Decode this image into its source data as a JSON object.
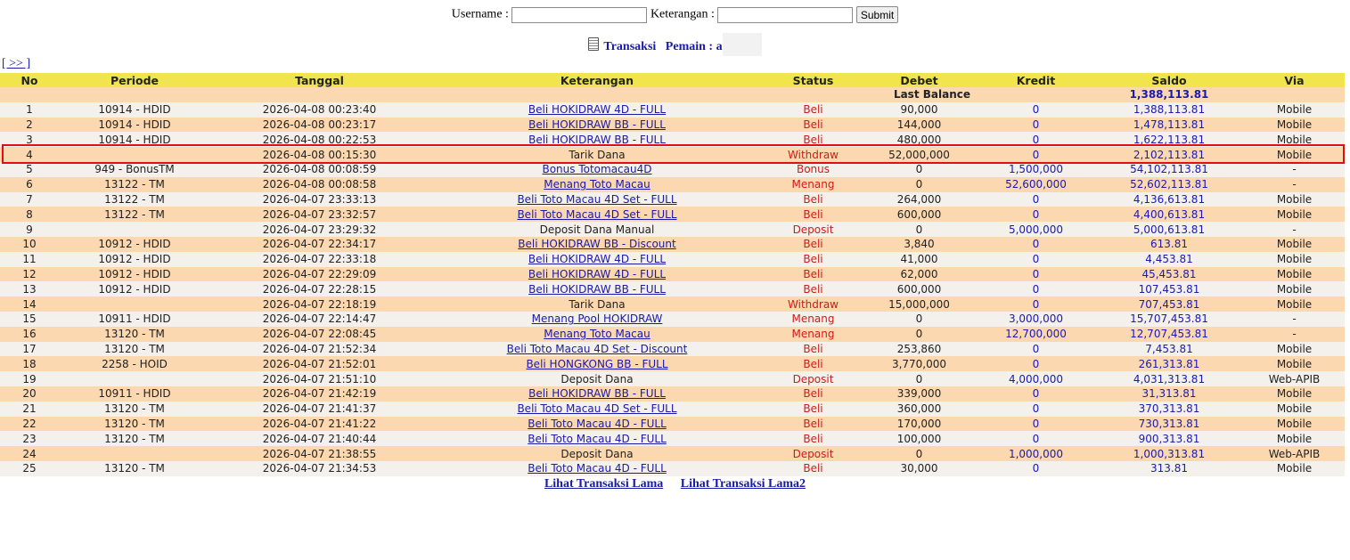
{
  "search": {
    "username_label": "Username :",
    "keterangan_label": "Keterangan :",
    "submit_label": "Submit"
  },
  "caption": {
    "title": "Transaksi",
    "player_label": "Pemain : a",
    "icon": "document-icon"
  },
  "nav": {
    "next_label": "[ >> ]"
  },
  "table": {
    "headers": [
      "No",
      "Periode",
      "Tanggal",
      "Keterangan",
      "Status",
      "Debet",
      "Kredit",
      "Saldo",
      "Via"
    ],
    "last_balance_label": "Last Balance",
    "last_balance_value": "1,388,113.81",
    "rows": [
      {
        "no": "1",
        "periode": "10914 - HDID",
        "tanggal": "2026-04-08 00:23:40",
        "ket": "Beli HOKIDRAW 4D - FULL",
        "link": true,
        "status": "Beli",
        "debet": "90,000",
        "kredit": "0",
        "saldo": "1,388,113.81",
        "via": "Mobile"
      },
      {
        "no": "2",
        "periode": "10914 - HDID",
        "tanggal": "2026-04-08 00:23:17",
        "ket": "Beli HOKIDRAW BB - FULL",
        "link": true,
        "status": "Beli",
        "debet": "144,000",
        "kredit": "0",
        "saldo": "1,478,113.81",
        "via": "Mobile"
      },
      {
        "no": "3",
        "periode": "10914 - HDID",
        "tanggal": "2026-04-08 00:22:53",
        "ket": "Beli HOKIDRAW BB - FULL",
        "link": true,
        "status": "Beli",
        "debet": "480,000",
        "kredit": "0",
        "saldo": "1,622,113.81",
        "via": "Mobile"
      },
      {
        "no": "4",
        "periode": "",
        "tanggal": "2026-04-08 00:15:30",
        "ket": "Tarik Dana",
        "link": false,
        "status": "Withdraw",
        "debet": "52,000,000",
        "kredit": "0",
        "saldo": "2,102,113.81",
        "via": "Mobile"
      },
      {
        "no": "5",
        "periode": "949 - BonusTM",
        "tanggal": "2026-04-08 00:08:59",
        "ket": "Bonus Totomacau4D",
        "link": true,
        "status": "Bonus",
        "debet": "0",
        "kredit": "1,500,000",
        "saldo": "54,102,113.81",
        "via": "-"
      },
      {
        "no": "6",
        "periode": "13122 - TM",
        "tanggal": "2026-04-08 00:08:58",
        "ket": "Menang Toto Macau",
        "link": true,
        "status": "Menang",
        "debet": "0",
        "kredit": "52,600,000",
        "saldo": "52,602,113.81",
        "via": "-"
      },
      {
        "no": "7",
        "periode": "13122 - TM",
        "tanggal": "2026-04-07 23:33:13",
        "ket": "Beli Toto Macau 4D Set - FULL",
        "link": true,
        "status": "Beli",
        "debet": "264,000",
        "kredit": "0",
        "saldo": "4,136,613.81",
        "via": "Mobile"
      },
      {
        "no": "8",
        "periode": "13122 - TM",
        "tanggal": "2026-04-07 23:32:57",
        "ket": "Beli Toto Macau 4D Set - FULL",
        "link": true,
        "status": "Beli",
        "debet": "600,000",
        "kredit": "0",
        "saldo": "4,400,613.81",
        "via": "Mobile"
      },
      {
        "no": "9",
        "periode": "",
        "tanggal": "2026-04-07 23:29:32",
        "ket": "Deposit Dana Manual",
        "link": false,
        "status": "Deposit",
        "debet": "0",
        "kredit": "5,000,000",
        "saldo": "5,000,613.81",
        "via": "-"
      },
      {
        "no": "10",
        "periode": "10912 - HDID",
        "tanggal": "2026-04-07 22:34:17",
        "ket": "Beli HOKIDRAW BB - Discount",
        "link": true,
        "status": "Beli",
        "debet": "3,840",
        "kredit": "0",
        "saldo": "613.81",
        "via": "Mobile"
      },
      {
        "no": "11",
        "periode": "10912 - HDID",
        "tanggal": "2026-04-07 22:33:18",
        "ket": "Beli HOKIDRAW 4D - FULL",
        "link": true,
        "status": "Beli",
        "debet": "41,000",
        "kredit": "0",
        "saldo": "4,453.81",
        "via": "Mobile"
      },
      {
        "no": "12",
        "periode": "10912 - HDID",
        "tanggal": "2026-04-07 22:29:09",
        "ket": "Beli HOKIDRAW 4D - FULL",
        "link": true,
        "status": "Beli",
        "debet": "62,000",
        "kredit": "0",
        "saldo": "45,453.81",
        "via": "Mobile"
      },
      {
        "no": "13",
        "periode": "10912 - HDID",
        "tanggal": "2026-04-07 22:28:15",
        "ket": "Beli HOKIDRAW BB - FULL",
        "link": true,
        "status": "Beli",
        "debet": "600,000",
        "kredit": "0",
        "saldo": "107,453.81",
        "via": "Mobile"
      },
      {
        "no": "14",
        "periode": "",
        "tanggal": "2026-04-07 22:18:19",
        "ket": "Tarik Dana",
        "link": false,
        "status": "Withdraw",
        "debet": "15,000,000",
        "kredit": "0",
        "saldo": "707,453.81",
        "via": "Mobile"
      },
      {
        "no": "15",
        "periode": "10911 - HDID",
        "tanggal": "2026-04-07 22:14:47",
        "ket": "Menang Pool HOKIDRAW",
        "link": true,
        "status": "Menang",
        "debet": "0",
        "kredit": "3,000,000",
        "saldo": "15,707,453.81",
        "via": "-"
      },
      {
        "no": "16",
        "periode": "13120 - TM",
        "tanggal": "2026-04-07 22:08:45",
        "ket": "Menang Toto Macau",
        "link": true,
        "status": "Menang",
        "debet": "0",
        "kredit": "12,700,000",
        "saldo": "12,707,453.81",
        "via": "-"
      },
      {
        "no": "17",
        "periode": "13120 - TM",
        "tanggal": "2026-04-07 21:52:34",
        "ket": "Beli Toto Macau 4D Set - Discount",
        "link": true,
        "status": "Beli",
        "debet": "253,860",
        "kredit": "0",
        "saldo": "7,453.81",
        "via": "Mobile"
      },
      {
        "no": "18",
        "periode": "2258 - HOID",
        "tanggal": "2026-04-07 21:52:01",
        "ket": "Beli HONGKONG BB - FULL",
        "link": true,
        "status": "Beli",
        "debet": "3,770,000",
        "kredit": "0",
        "saldo": "261,313.81",
        "via": "Mobile"
      },
      {
        "no": "19",
        "periode": "",
        "tanggal": "2026-04-07 21:51:10",
        "ket": "Deposit Dana",
        "link": false,
        "status": "Deposit",
        "debet": "0",
        "kredit": "4,000,000",
        "saldo": "4,031,313.81",
        "via": "Web-APIB"
      },
      {
        "no": "20",
        "periode": "10911 - HDID",
        "tanggal": "2026-04-07 21:42:19",
        "ket": "Beli HOKIDRAW BB - FULL",
        "link": true,
        "status": "Beli",
        "debet": "339,000",
        "kredit": "0",
        "saldo": "31,313.81",
        "via": "Mobile"
      },
      {
        "no": "21",
        "periode": "13120 - TM",
        "tanggal": "2026-04-07 21:41:37",
        "ket": "Beli Toto Macau 4D Set - FULL",
        "link": true,
        "status": "Beli",
        "debet": "360,000",
        "kredit": "0",
        "saldo": "370,313.81",
        "via": "Mobile"
      },
      {
        "no": "22",
        "periode": "13120 - TM",
        "tanggal": "2026-04-07 21:41:22",
        "ket": "Beli Toto Macau 4D - FULL",
        "link": true,
        "status": "Beli",
        "debet": "170,000",
        "kredit": "0",
        "saldo": "730,313.81",
        "via": "Mobile"
      },
      {
        "no": "23",
        "periode": "13120 - TM",
        "tanggal": "2026-04-07 21:40:44",
        "ket": "Beli Toto Macau 4D - FULL",
        "link": true,
        "status": "Beli",
        "debet": "100,000",
        "kredit": "0",
        "saldo": "900,313.81",
        "via": "Mobile"
      },
      {
        "no": "24",
        "periode": "",
        "tanggal": "2026-04-07 21:38:55",
        "ket": "Deposit Dana",
        "link": false,
        "status": "Deposit",
        "debet": "0",
        "kredit": "1,000,000",
        "saldo": "1,000,313.81",
        "via": "Web-APIB"
      },
      {
        "no": "25",
        "periode": "13120 - TM",
        "tanggal": "2026-04-07 21:34:53",
        "ket": "Beli Toto Macau 4D - FULL",
        "link": true,
        "status": "Beli",
        "debet": "30,000",
        "kredit": "0",
        "saldo": "313.81",
        "via": "Mobile"
      }
    ]
  },
  "footer": {
    "link1": "Lihat Transaksi Lama",
    "link2": "Lihat Transaksi Lama2"
  },
  "colors": {
    "header_bg": "#f1e44c",
    "row_odd": "#f4f0ec",
    "row_even": "#fbd8b0",
    "link": "#1a1aa6",
    "status_red": "#d21a1a",
    "highlight_border": "#e01010"
  }
}
